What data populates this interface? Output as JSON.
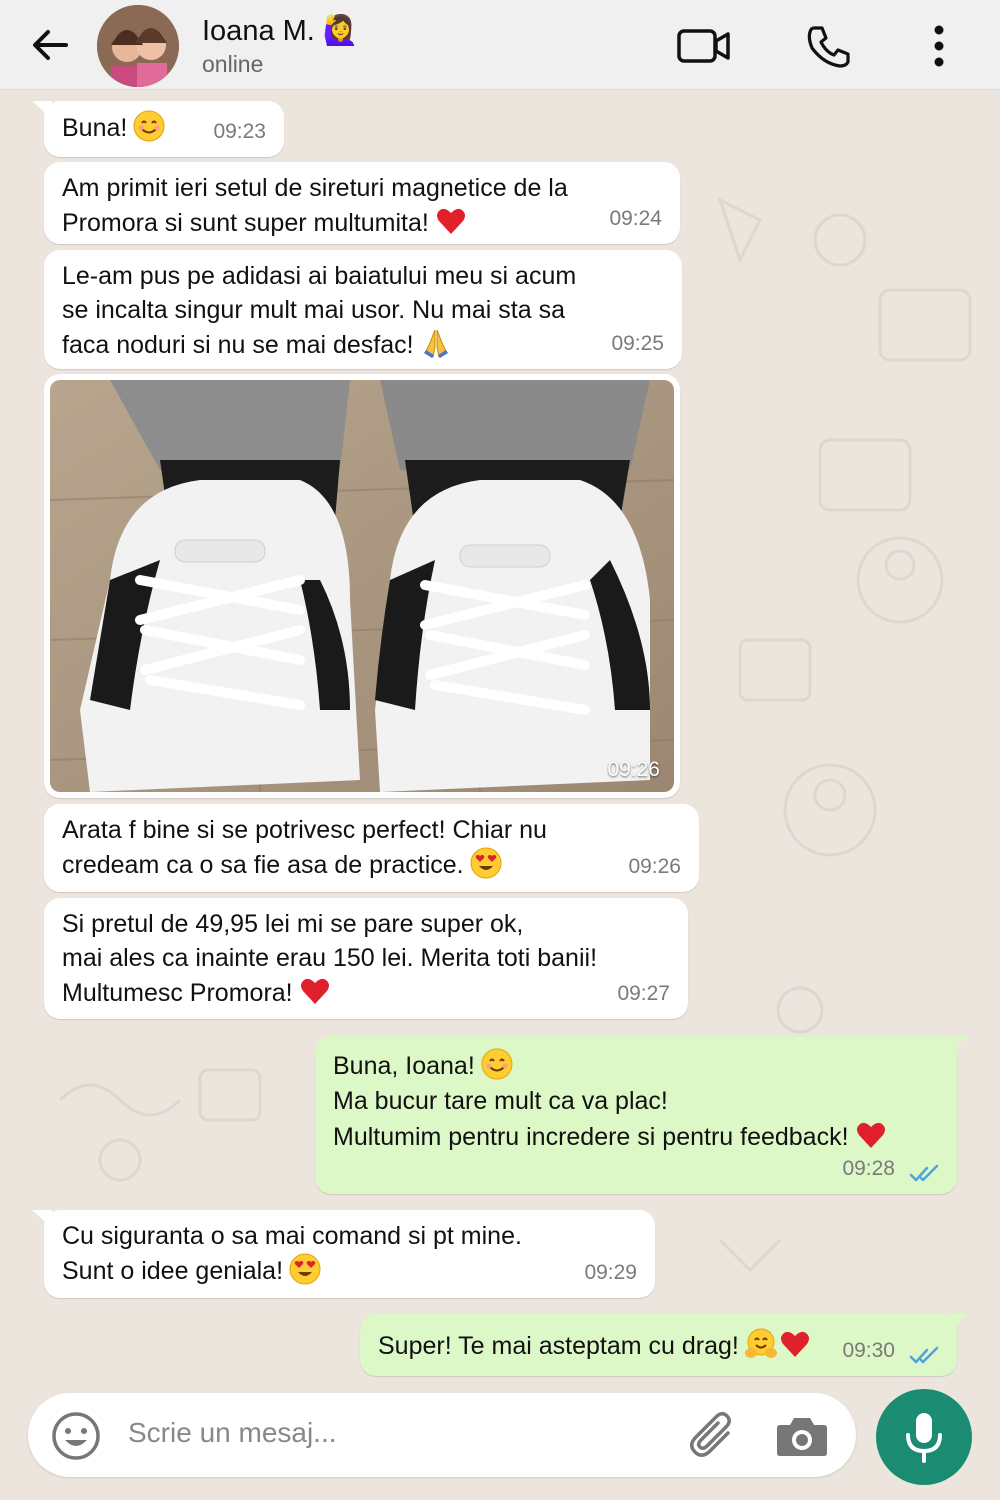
{
  "header": {
    "contact_name": "Ioana M. 🙋‍♀️",
    "status": "online",
    "icons": [
      "back-arrow-icon",
      "video-call-icon",
      "phone-icon",
      "more-options-icon"
    ]
  },
  "messages": [
    {
      "dir": "in",
      "text": "Buna!",
      "time": "09:23"
    },
    {
      "dir": "in",
      "lines": [
        "Am primit ieri setul de sireturi magnetice de la",
        "Promora si sunt super multumita!"
      ],
      "time": "09:24"
    },
    {
      "dir": "in",
      "lines": [
        "Le-am pus pe adidasi ai baiatului meu si acum",
        "se incalta singur mult mai usor. Nu mai sta sa",
        "faca noduri si nu se mai desfac!"
      ],
      "time": "09:25"
    },
    {
      "dir": "in",
      "type": "image",
      "alt": "sneakers with magnetic laces",
      "time": "09:26"
    },
    {
      "dir": "in",
      "lines": [
        "Arata f bine si se potrivesc perfect! Chiar nu",
        "credeam ca o sa fie asa de practice."
      ],
      "time": "09:26"
    },
    {
      "dir": "in",
      "lines": [
        "Si pretul de 49,95 lei mi se pare super ok,",
        "mai ales ca inainte erau 150 lei. Merita toti banii!",
        "Multumesc Promora!"
      ],
      "time": "09:27"
    },
    {
      "dir": "out",
      "lines": [
        "Buna, Ioana!",
        "Ma bucur tare mult ca va plac!",
        "Multumim pentru incredere si pentru feedback!"
      ],
      "time": "09:28",
      "read": true
    },
    {
      "dir": "in",
      "lines": [
        "Cu siguranta o sa mai comand si pt mine.",
        "Sunt o idee geniala!"
      ],
      "time": "09:29"
    },
    {
      "dir": "out",
      "text": "Super! Te mai asteptam cu drag!",
      "time": "09:30",
      "read": true
    }
  ],
  "input": {
    "placeholder": "Scrie un mesaj..."
  },
  "colors": {
    "incoming": "#ffffff",
    "outgoing": "#dcf8c6",
    "accent": "#1b8c72",
    "read_ticks": "#4fa3e0",
    "background": "#ece5dd"
  }
}
